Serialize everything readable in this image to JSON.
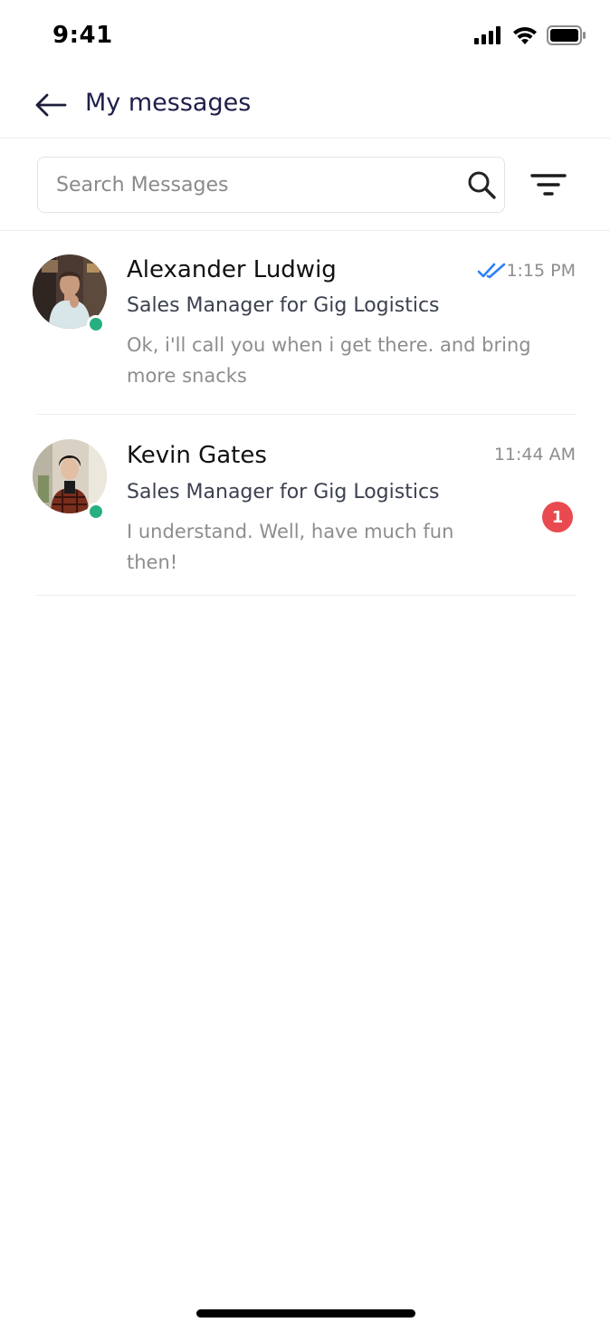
{
  "status_bar": {
    "time": "9:41",
    "icons": [
      "cellular-signal-icon",
      "wifi-icon",
      "battery-icon"
    ]
  },
  "header": {
    "back_icon": "arrow-left-icon",
    "title": "My messages"
  },
  "search": {
    "placeholder": "Search Messages",
    "value": "",
    "search_icon": "search-icon",
    "filter_icon": "filter-icon"
  },
  "conversations": [
    {
      "name": "Alexander Ludwig",
      "role": "Sales Manager for Gig Logistics",
      "preview": "Ok, i'll call you when i get there. and bring more snacks",
      "time": "1:15 PM",
      "online": true,
      "read": true,
      "unread_count": null
    },
    {
      "name": "Kevin Gates",
      "role": "Sales Manager for Gig Logistics",
      "preview": "I understand. Well, have much fun then!",
      "time": "11:44 AM",
      "online": true,
      "read": false,
      "unread_count": "1"
    }
  ],
  "colors": {
    "online": "#27b07f",
    "read_check": "#2d7ff9",
    "unread_badge": "#e84a4f",
    "title": "#1d1f4a"
  }
}
